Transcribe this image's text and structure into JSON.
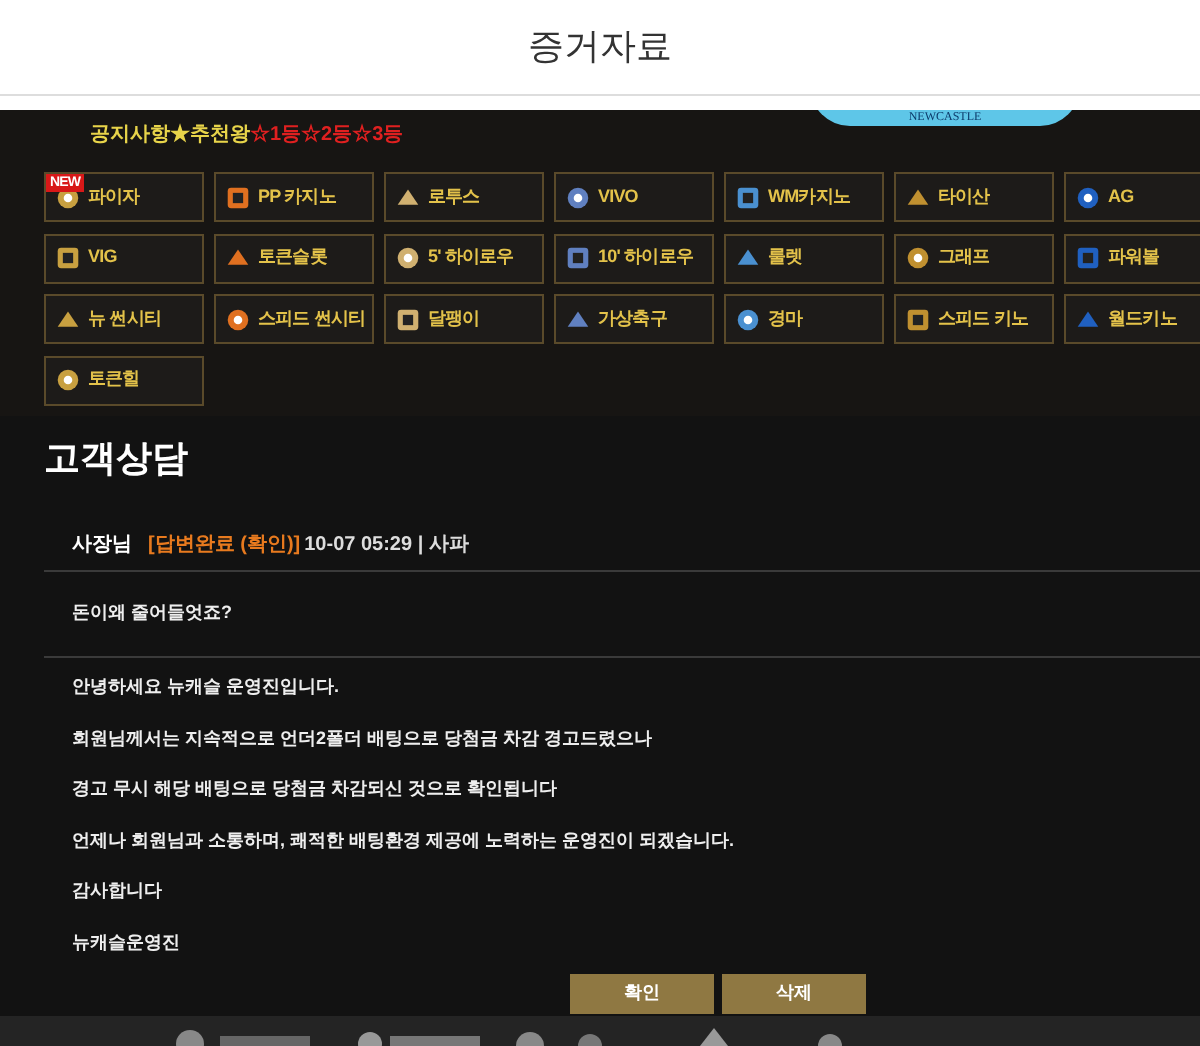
{
  "header": {
    "title": "증거자료"
  },
  "logo": {
    "text": "NEWCASTLE"
  },
  "notice": {
    "label": "공지사항★추천왕",
    "ranks": "☆1등☆2등☆3등"
  },
  "games": [
    {
      "label": "파이자",
      "new": true
    },
    {
      "label": "PP 카지노",
      "new": false
    },
    {
      "label": "로투스",
      "new": false
    },
    {
      "label": "VIVO",
      "new": false
    },
    {
      "label": "WM카지노",
      "new": false
    },
    {
      "label": "타이산",
      "new": false
    },
    {
      "label": "AG",
      "new": false
    },
    {
      "label": "VIG",
      "new": false
    },
    {
      "label": "토큰슬롯",
      "new": false
    },
    {
      "label": "5' 하이로우",
      "new": false
    },
    {
      "label": "10' 하이로우",
      "new": false
    },
    {
      "label": "룰렛",
      "new": false
    },
    {
      "label": "그래프",
      "new": false
    },
    {
      "label": "파워볼",
      "new": false
    },
    {
      "label": "뉴 썬시티",
      "new": false
    },
    {
      "label": "스피드 썬시티",
      "new": false
    },
    {
      "label": "달팽이",
      "new": false
    },
    {
      "label": "가상축구",
      "new": false
    },
    {
      "label": "경마",
      "new": false
    },
    {
      "label": "스피드 키노",
      "new": false
    },
    {
      "label": "월드키노",
      "new": false
    },
    {
      "label": "토큰힐",
      "new": false
    }
  ],
  "new_badge": "NEW",
  "section_title": "고객상담",
  "post": {
    "author": "사장님",
    "status": "[답변완료 (확인)]",
    "meta": "10-07 05:29 | 사파",
    "question": "돈이왜 줄어들엇죠?",
    "answer": [
      "안녕하세요 뉴캐슬 운영진입니다.",
      "회원님께서는 지속적으로 언더2폴더 배팅으로 당첨금 차감 경고드렸으나",
      "경고 무시 해당 배팅으로 당첨금 차감되신 것으로 확인됩니다",
      "언제나 회원님과 소통하며, 쾌적한 배팅환경 제공에 노력하는 운영진이 되겠습니다.",
      "감사합니다",
      "뉴캐슬운영진"
    ]
  },
  "buttons": [
    "확인",
    "삭제"
  ]
}
